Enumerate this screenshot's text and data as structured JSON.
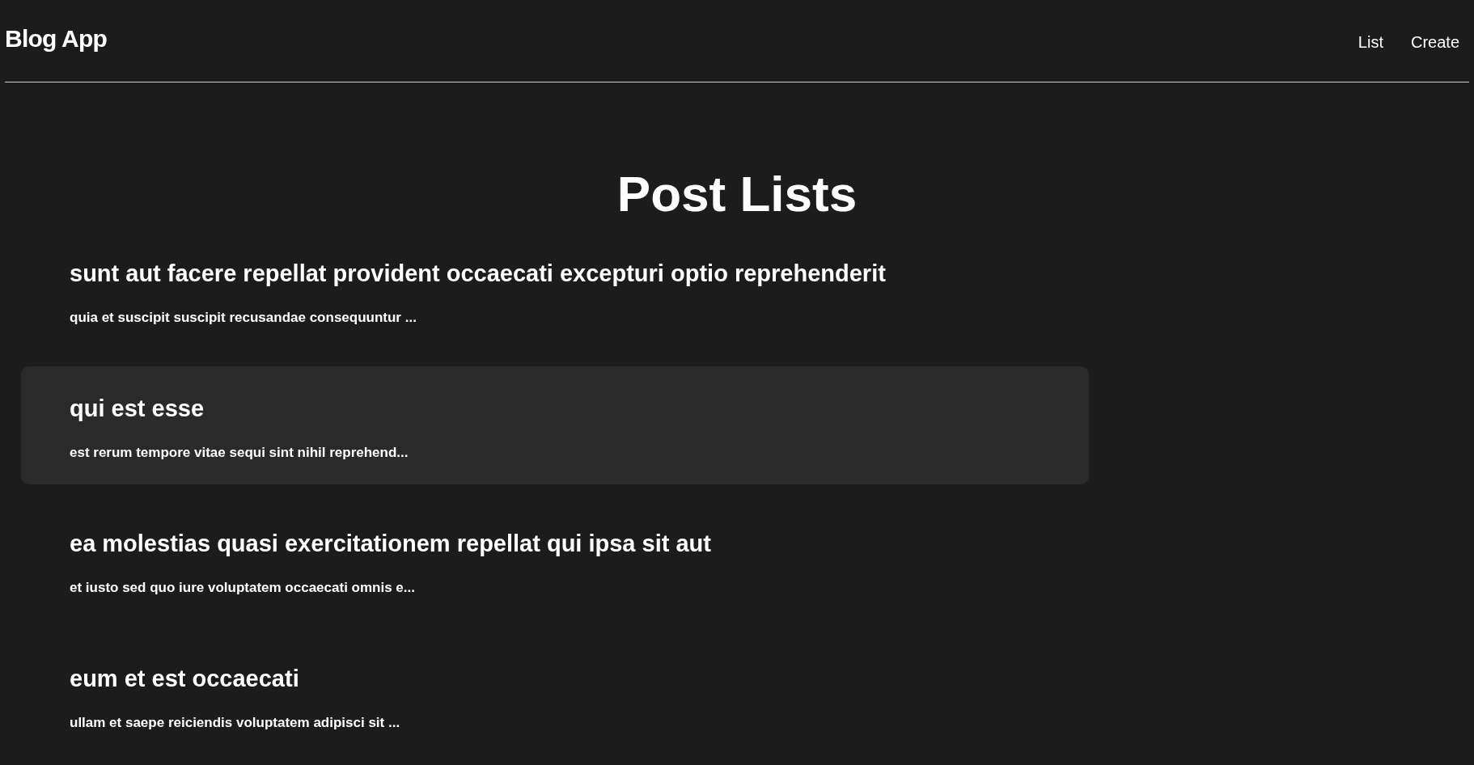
{
  "header": {
    "brand": "Blog App",
    "nav": [
      "List",
      "Create"
    ]
  },
  "page_title": "Post Lists",
  "posts": [
    {
      "title": "sunt aut facere repellat provident occaecati excepturi optio reprehenderit",
      "excerpt": "quia et suscipit suscipit recusandae consequuntur ...",
      "highlighted": false
    },
    {
      "title": "qui est esse",
      "excerpt": "est rerum tempore vitae sequi sint nihil reprehend...",
      "highlighted": true
    },
    {
      "title": "ea molestias quasi exercitationem repellat qui ipsa sit aut",
      "excerpt": "et iusto sed quo iure voluptatem occaecati omnis e...",
      "highlighted": false
    },
    {
      "title": "eum et est occaecati",
      "excerpt": "ullam et saepe reiciendis voluptatem adipisci sit ...",
      "highlighted": false
    }
  ]
}
